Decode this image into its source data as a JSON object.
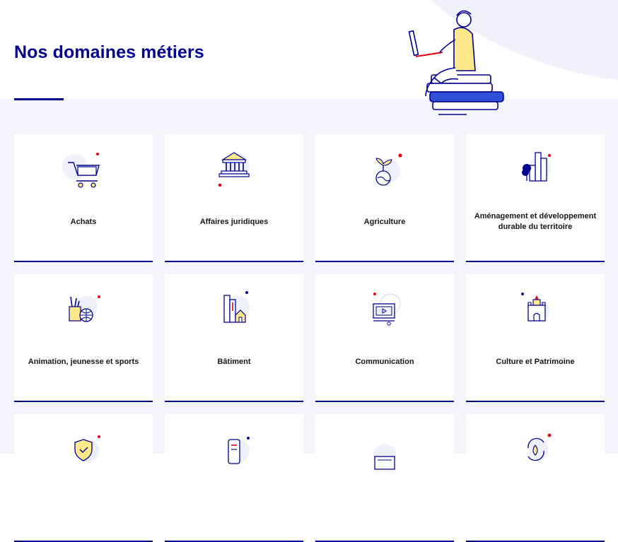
{
  "page": {
    "title": "Nos domaines métiers"
  },
  "colors": {
    "accent": "#000091",
    "red_dot": "#e1000f",
    "background_band": "#f4f5fc"
  },
  "domains": [
    {
      "label": "Achats",
      "icon": "shopping-cart-icon"
    },
    {
      "label": "Affaires juridiques",
      "icon": "courthouse-icon"
    },
    {
      "label": "Agriculture",
      "icon": "plant-globe-icon"
    },
    {
      "label": "Aménagement et développement durable du territoire",
      "icon": "city-tree-icon"
    },
    {
      "label": "Animation, jeunesse et sports",
      "icon": "sports-icon"
    },
    {
      "label": "Bâtiment",
      "icon": "buildings-house-icon"
    },
    {
      "label": "Communication",
      "icon": "video-screen-icon"
    },
    {
      "label": "Culture et Patrimoine",
      "icon": "castle-icon"
    },
    {
      "label": "",
      "icon": "shield-check-icon"
    },
    {
      "label": "",
      "icon": "document-roll-icon"
    },
    {
      "label": "",
      "icon": "monitor-icon"
    },
    {
      "label": "",
      "icon": "eco-cycle-icon"
    }
  ]
}
